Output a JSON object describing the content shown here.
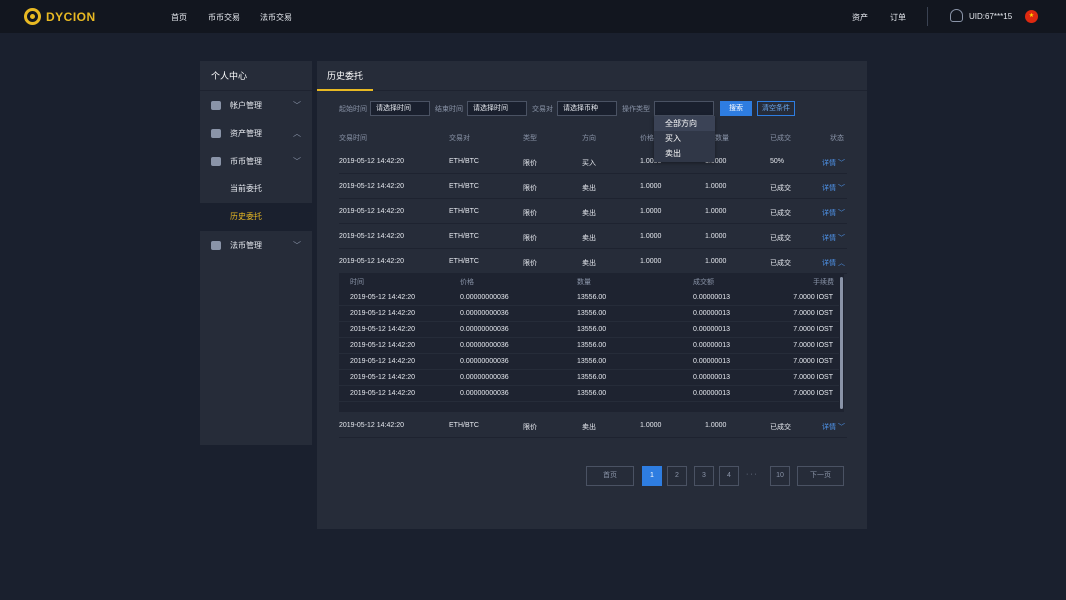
{
  "brand": {
    "name": "DYCION",
    "color": "#e8b923"
  },
  "nav": {
    "home": "首页",
    "coin": "币币交易",
    "fiat": "法币交易",
    "assets": "资产",
    "orders": "订单",
    "uid": "UID:67***15"
  },
  "sidebar": {
    "title": "个人中心",
    "items": [
      "帐户管理",
      "资产管理",
      "币币管理",
      "法币管理"
    ],
    "subs": [
      "当前委托",
      "历史委托"
    ]
  },
  "panel": {
    "tab": "历史委托"
  },
  "filters": {
    "start_label": "起始时间",
    "start_value": "请选择时间",
    "end_label": "结束时间",
    "end_value": "请选择时间",
    "pair_label": "交易对",
    "pair_value": "请选择币种",
    "type_label": "操作类型",
    "search": "搜索",
    "clear": "清空条件"
  },
  "dropdown": [
    "全部方向",
    "买入",
    "卖出"
  ],
  "columns": [
    "交易时间",
    "交易对",
    "类型",
    "方向",
    "价格",
    "数量",
    "已成交",
    "状态"
  ],
  "rows": [
    [
      "2019-05-12 14:42:20",
      "ETH/BTC",
      "限价",
      "买入",
      "1.0000",
      "1.0000",
      "50%",
      "详情"
    ],
    [
      "2019-05-12 14:42:20",
      "ETH/BTC",
      "限价",
      "卖出",
      "1.0000",
      "1.0000",
      "已成交",
      "详情"
    ],
    [
      "2019-05-12 14:42:20",
      "ETH/BTC",
      "限价",
      "卖出",
      "1.0000",
      "1.0000",
      "已成交",
      "详情"
    ],
    [
      "2019-05-12 14:42:20",
      "ETH/BTC",
      "限价",
      "卖出",
      "1.0000",
      "1.0000",
      "已成交",
      "详情"
    ],
    [
      "2019-05-12 14:42:20",
      "ETH/BTC",
      "限价",
      "卖出",
      "1.0000",
      "1.0000",
      "已成交",
      "详情"
    ],
    [
      "2019-05-12 14:42:20",
      "ETH/BTC",
      "限价",
      "卖出",
      "1.0000",
      "1.0000",
      "已成交",
      "详情"
    ]
  ],
  "detail": {
    "columns": [
      "时间",
      "价格",
      "数量",
      "成交额",
      "手续费"
    ],
    "rows": [
      [
        "2019-05-12 14:42:20",
        "0.00000000036",
        "13556.00",
        "0.00000013",
        "7.0000 IOST"
      ],
      [
        "2019-05-12 14:42:20",
        "0.00000000036",
        "13556.00",
        "0.00000013",
        "7.0000 IOST"
      ],
      [
        "2019-05-12 14:42:20",
        "0.00000000036",
        "13556.00",
        "0.00000013",
        "7.0000 IOST"
      ],
      [
        "2019-05-12 14:42:20",
        "0.00000000036",
        "13556.00",
        "0.00000013",
        "7.0000 IOST"
      ],
      [
        "2019-05-12 14:42:20",
        "0.00000000036",
        "13556.00",
        "0.00000013",
        "7.0000 IOST"
      ],
      [
        "2019-05-12 14:42:20",
        "0.00000000036",
        "13556.00",
        "0.00000013",
        "7.0000 IOST"
      ],
      [
        "2019-05-12 14:42:20",
        "0.00000000036",
        "13556.00",
        "0.00000013",
        "7.0000 IOST"
      ]
    ]
  },
  "pagination": {
    "first": "首页",
    "pages": [
      "1",
      "2",
      "3",
      "4"
    ],
    "ellipsis": "· · ·",
    "last_page": "10",
    "next": "下一页"
  }
}
